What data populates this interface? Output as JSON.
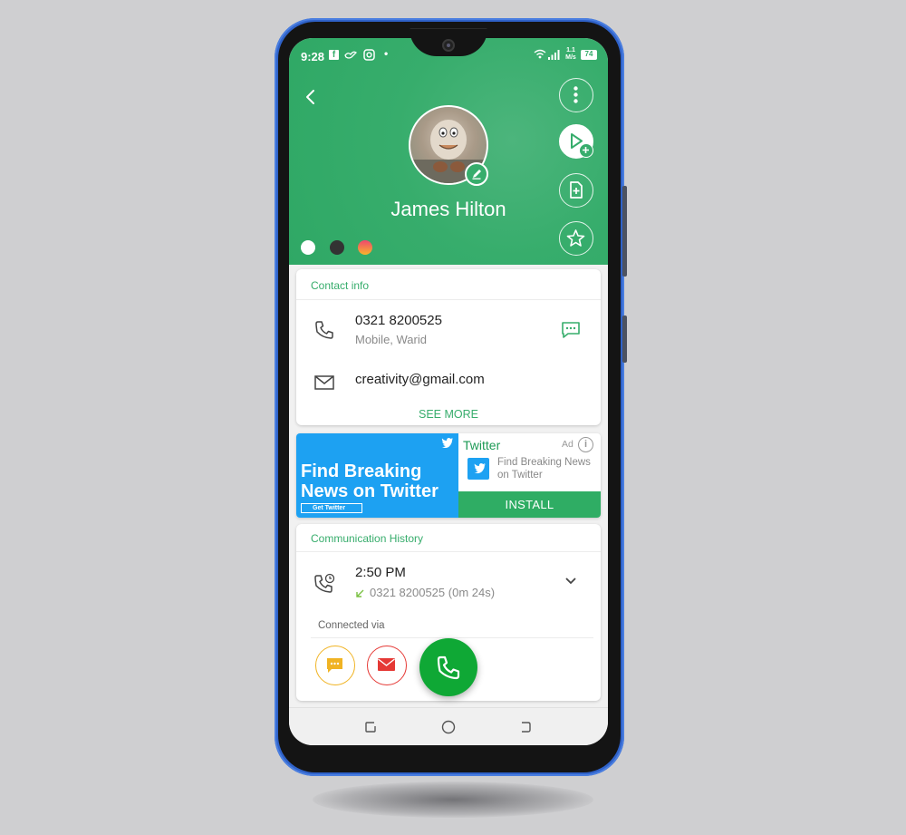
{
  "status_bar": {
    "time": "9:28",
    "speed": "1.1 M/s",
    "battery": "74"
  },
  "contact": {
    "name": "James Hilton"
  },
  "theme_colors": [
    "#ffffff",
    "#333333",
    "#f0466e"
  ],
  "colors": {
    "accent": "#37ad6c",
    "fab": "#0fa835",
    "twitter": "#1da1f2"
  },
  "contact_info": {
    "title": "Contact info",
    "phone": "0321 8200525",
    "phone_label": "Mobile, Warid",
    "email": "creativity@gmail.com",
    "see_more": "SEE MORE"
  },
  "ad": {
    "banner_line1": "Find Breaking",
    "banner_line2": "News on Twitter",
    "banner_cta": "Get Twitter",
    "title": "Twitter",
    "tag": "Ad",
    "description": "Find Breaking News on Twitter",
    "install": "INSTALL"
  },
  "history": {
    "title": "Communication History",
    "time": "2:50 PM",
    "detail": "0321 8200525 (0m 24s)",
    "connected_via": "Connected via"
  }
}
